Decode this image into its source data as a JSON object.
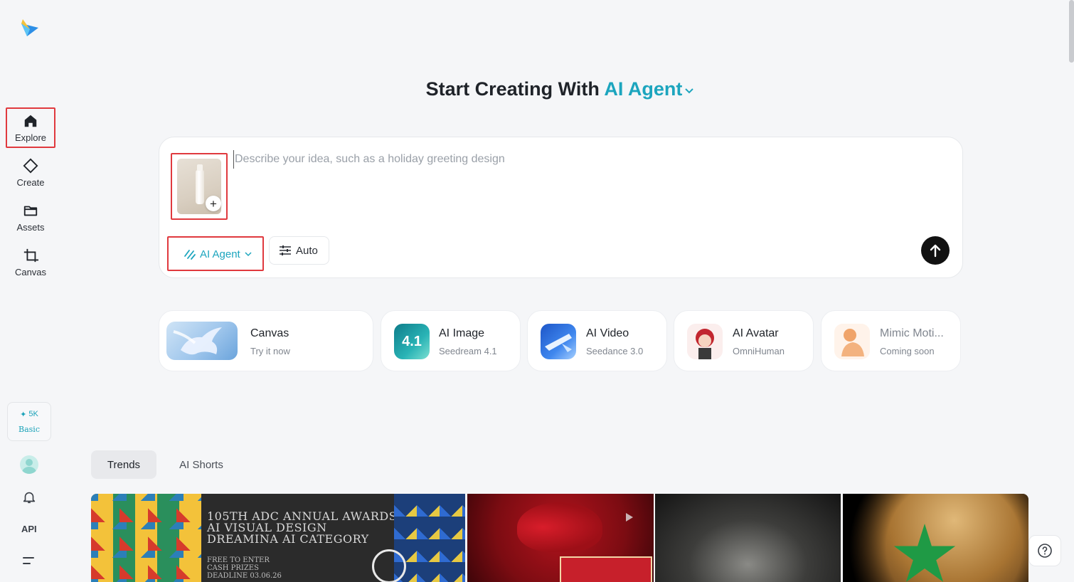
{
  "sidebar": {
    "items": [
      {
        "label": "Explore",
        "icon": "home-icon"
      },
      {
        "label": "Create",
        "icon": "diamond-icon"
      },
      {
        "label": "Assets",
        "icon": "folder-icon"
      },
      {
        "label": "Canvas",
        "icon": "crop-icon"
      }
    ],
    "credits": {
      "amount": "5K",
      "plan": "Basic"
    },
    "api_label": "API"
  },
  "headline": {
    "prefix": "Start Creating With",
    "mode": "AI Agent"
  },
  "prompt": {
    "placeholder": "Describe your idea, such as a holiday greeting design",
    "value": "",
    "agent_label": "AI Agent",
    "auto_label": "Auto"
  },
  "tools": [
    {
      "title": "Canvas",
      "subtitle": "Try it now"
    },
    {
      "title": "AI Image",
      "subtitle": "Seedream 4.1",
      "badge": "4.1"
    },
    {
      "title": "AI Video",
      "subtitle": "Seedance 3.0"
    },
    {
      "title": "AI Avatar",
      "subtitle": "OmniHuman"
    },
    {
      "title": "Mimic Moti...",
      "subtitle": "Coming soon"
    }
  ],
  "tabs": [
    {
      "label": "Trends",
      "active": true
    },
    {
      "label": "AI Shorts",
      "active": false
    }
  ],
  "gallery": {
    "poster_title": [
      "105TH ADC ANNUAL AWARDS",
      "AI VISUAL DESIGN",
      "DREAMINA AI CATEGORY"
    ],
    "poster_details": [
      "FREE TO ENTER",
      "CASH PRIZES",
      "DEADLINE 03.06.26"
    ]
  },
  "colors": {
    "accent": "#1ca5be",
    "highlight": "#e0393e"
  }
}
